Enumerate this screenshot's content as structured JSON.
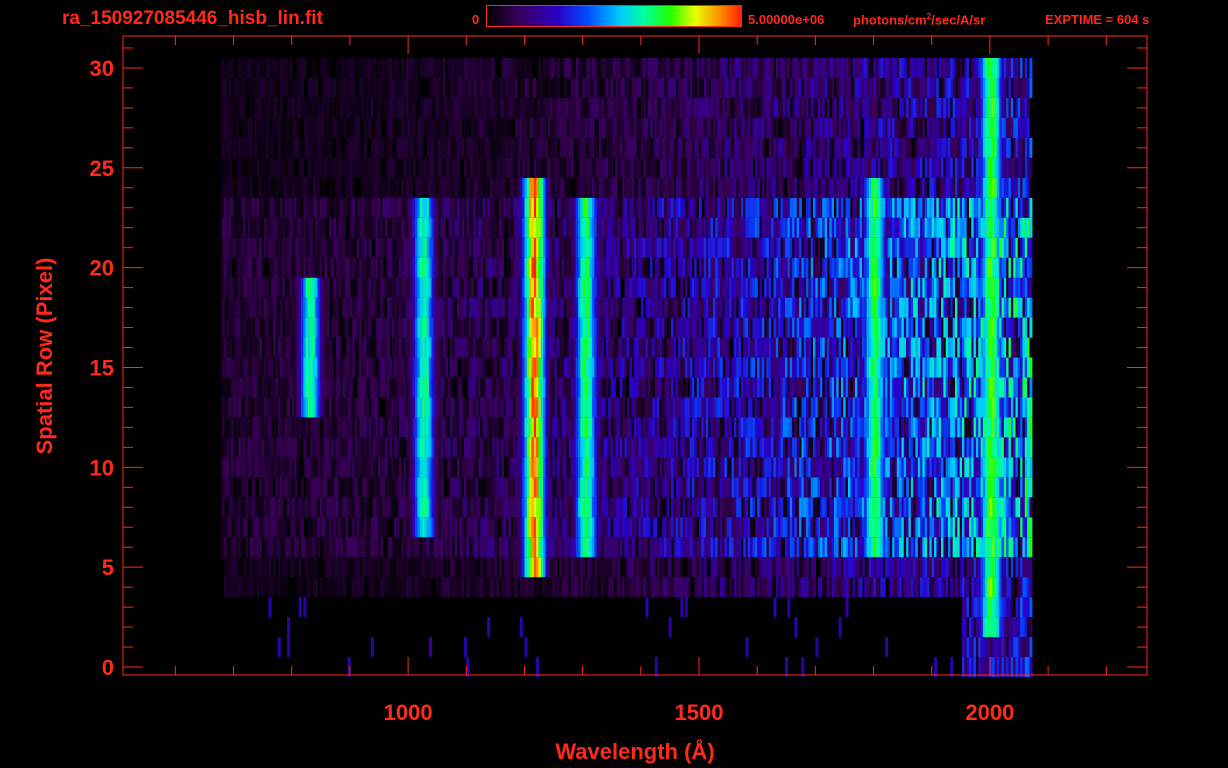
{
  "header": {
    "file_title": "ra_150927085446_hisb_lin.fit",
    "colorbar_min_label": "0",
    "colorbar_max_label": "5.00000e+06",
    "colorbar_units_pre": "photons/cm",
    "colorbar_units_sup": "2",
    "colorbar_units_post": "/sec/A/sr",
    "exptime_label": "EXPTIME = 604 s"
  },
  "colors": {
    "axis": "#ff2a1a",
    "background": "#000000",
    "colormap": [
      "#000000",
      "#3a0058",
      "#2a00c8",
      "#0050ff",
      "#00c8ff",
      "#00ffa0",
      "#20ff00",
      "#e8ff00",
      "#ff8a00",
      "#ff2000"
    ]
  },
  "chart_data": {
    "type": "heatmap",
    "title": "",
    "xlabel": "Wavelength (Å)",
    "ylabel": "Spatial Row (Pixel)",
    "xlim": [
      510,
      2270
    ],
    "ylim": [
      -0.4,
      31.6
    ],
    "x_ticks": [
      1000,
      1500,
      2000
    ],
    "y_ticks": [
      0,
      5,
      10,
      15,
      20,
      25,
      30
    ],
    "grid": false,
    "colorbar": {
      "min": 0,
      "max": 5000000,
      "colormap": "rainbow"
    },
    "signal_extent": {
      "x_start": 680,
      "x_end": 2070,
      "row_min": 0,
      "row_max": 30
    },
    "emission_features": [
      {
        "wavelength": 830,
        "row_min": 13,
        "row_max": 19,
        "intensity": 0.55
      },
      {
        "wavelength": 1025,
        "row_min": 7,
        "row_max": 23,
        "intensity": 0.55
      },
      {
        "wavelength": 1215,
        "row_min": 5,
        "row_max": 24,
        "intensity": 0.9
      },
      {
        "wavelength": 1304,
        "row_min": 6,
        "row_max": 23,
        "intensity": 0.6
      },
      {
        "wavelength": 1800,
        "row_min": 6,
        "row_max": 24,
        "intensity": 0.62
      },
      {
        "wavelength": 2000,
        "row_min": 2,
        "row_max": 30,
        "intensity": 0.65
      }
    ]
  }
}
